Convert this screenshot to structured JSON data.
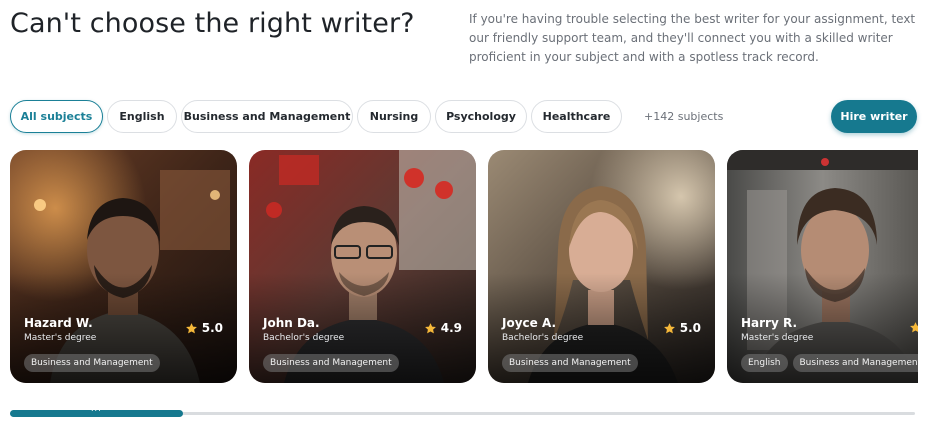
{
  "header": {
    "title": "Can't choose the right writer?",
    "intro": "If you're having trouble selecting the best writer for your assignment, text our friendly support team, and they'll connect you with a skilled writer proficient in your subject and with a spotless track record."
  },
  "filters": {
    "subjects": [
      "All subjects",
      "English",
      "Business and Management",
      "Nursing",
      "Psychology",
      "Healthcare"
    ],
    "active": "All subjects",
    "more_count": "+142 subjects",
    "hire_button": "Hire writer"
  },
  "writers": [
    {
      "name": "Hazard W.",
      "degree": "Master's degree",
      "rating": "5.0",
      "tags": [
        "Business and Management"
      ]
    },
    {
      "name": "John Da.",
      "degree": "Bachelor's degree",
      "rating": "4.9",
      "tags": [
        "Business and Management"
      ]
    },
    {
      "name": "Joyce A.",
      "degree": "Bachelor's degree",
      "rating": "5.0",
      "tags": [
        "Business and Management"
      ]
    },
    {
      "name": "Harry R.",
      "degree": "Master's degree",
      "rating": "",
      "tags": [
        "English",
        "Business and Management"
      ]
    }
  ],
  "carousel": {
    "progress_fraction": 0.19,
    "handle_dots": "..."
  },
  "colors": {
    "accent": "#16798f",
    "star": "#f5b83a"
  }
}
